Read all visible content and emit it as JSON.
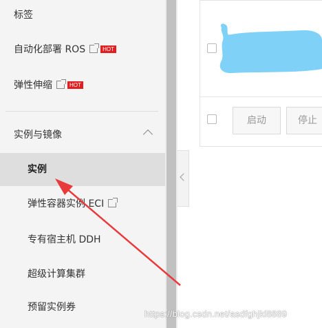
{
  "sidebar": {
    "items": [
      {
        "label": "标签"
      },
      {
        "label": "自动化部署 ROS",
        "hot": "HOT"
      },
      {
        "label": "弹性伸缩",
        "hot": "HOT"
      }
    ],
    "group": {
      "label": "实例与镜像"
    },
    "sub_items": [
      {
        "label": "实例",
        "active": true
      },
      {
        "label": "弹性容器实例 ECI"
      },
      {
        "label": "专有宿主机 DDH"
      },
      {
        "label": "超级计算集群"
      },
      {
        "label": "预留实例券"
      }
    ]
  },
  "main": {
    "buttons": {
      "start": "启动",
      "stop": "停止"
    }
  },
  "annotation": {
    "arrow_color": "#e83a3a"
  },
  "watermark": "https://blog.csdn.net/asdfghjkl8889",
  "colors": {
    "hot_badge": "#e02020",
    "redacted_blob": "#80d1f7"
  }
}
